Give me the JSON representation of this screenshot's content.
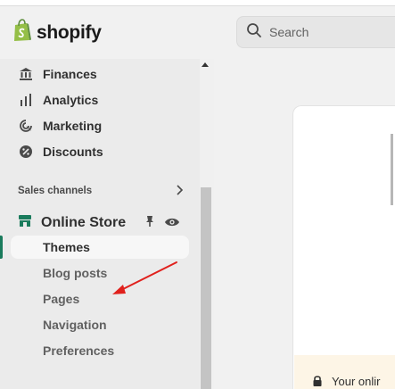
{
  "brand": {
    "name": "shopify",
    "accent": "#1a7b5c",
    "logo_icon": "shopping-bag-icon"
  },
  "search": {
    "placeholder": "Search",
    "icon": "search-icon"
  },
  "sidebar": {
    "items": [
      {
        "label": "Finances",
        "icon": "bank-icon"
      },
      {
        "label": "Analytics",
        "icon": "bar-chart-icon"
      },
      {
        "label": "Marketing",
        "icon": "target-icon"
      },
      {
        "label": "Discounts",
        "icon": "discount-icon"
      }
    ],
    "section_title": "Sales channels",
    "online_store": {
      "label": "Online Store",
      "icon": "store-icon",
      "actions": [
        "pin-icon",
        "eye-icon"
      ]
    },
    "sub_items": [
      {
        "label": "Themes",
        "active": true
      },
      {
        "label": "Blog posts",
        "active": false
      },
      {
        "label": "Pages",
        "active": false
      },
      {
        "label": "Navigation",
        "active": false
      },
      {
        "label": "Preferences",
        "active": false
      }
    ]
  },
  "main": {
    "banner": {
      "text": "Your onlir",
      "icon": "lock-icon",
      "color": "#fdf5e6"
    }
  },
  "annotation": {
    "arrow_color": "#e0201c"
  }
}
